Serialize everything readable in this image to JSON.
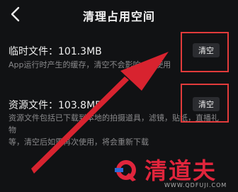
{
  "header": {
    "title": "清理占用空间"
  },
  "temp_files": {
    "label": "临时文件：101.3MB",
    "description": "App运行时产生的缓存，清空不会影响app使用",
    "button_label": "清空"
  },
  "resource_files": {
    "label": "资源文件：103.8MB",
    "description_line1": "资源文件包括已下载到本地的拍摄道具，滤镜，贴纸，直播礼物",
    "description_line2": "等，清空后如需再次使用，将会重新下载",
    "button_label": "清空"
  },
  "watermark": {
    "brand": "清道夫",
    "url": "WWW.QDFUJI.COM"
  },
  "colors": {
    "background": "#111214",
    "button_bg": "#2b2c30",
    "annotation_red": "#e23b3b",
    "watermark_red": "#e0253c"
  }
}
